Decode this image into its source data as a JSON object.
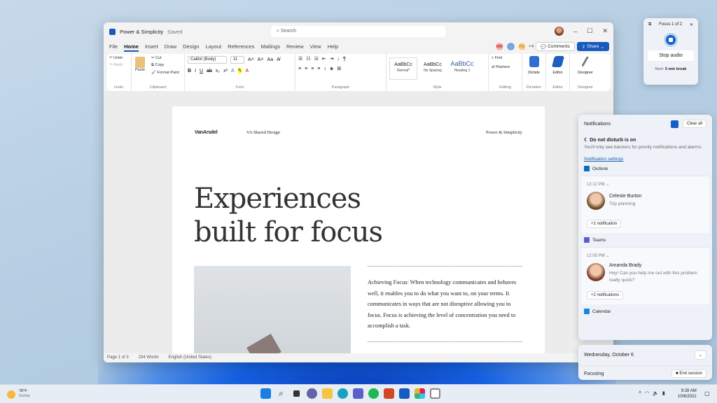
{
  "word": {
    "doc_title": "Power & Simplicity",
    "save_state": "Saved",
    "search_placeholder": "Search",
    "tabs": [
      "File",
      "Home",
      "Insert",
      "Draw",
      "Design",
      "Layout",
      "References",
      "Mailings",
      "Review",
      "View",
      "Help"
    ],
    "active_tab": "Home",
    "collaborators": [
      "MM",
      "",
      "FS"
    ],
    "collab_more": "+4",
    "comments_label": "Comments",
    "share_label": "Share",
    "ribbon": {
      "undo": "Undo",
      "redo": "Redo",
      "undo_group": "Undo",
      "paste": "Paste",
      "cut": "Cut",
      "copy": "Copy",
      "format_paint": "Format Paint",
      "clipboard_group": "Clipboard",
      "font_name": "Calibri (Body)",
      "font_size": "11",
      "font_group": "Font",
      "paragraph_group": "Paragraph",
      "styles": [
        {
          "sample": "AaBbCc",
          "name": "Normal*"
        },
        {
          "sample": "AaBbCc",
          "name": "No Spacing"
        },
        {
          "sample": "AaBbCc",
          "name": "Heading 1"
        }
      ],
      "style_group": "Style",
      "find": "Find",
      "replace": "Replace",
      "editing_group": "Editing",
      "dictate": "Dictate",
      "dictation_group": "Dictation",
      "editor": "Editor",
      "editor_group": "Editor",
      "designer": "Designer",
      "designer_group": "Designer"
    },
    "page": {
      "brand": "VanArsdel",
      "header_center": "VA Shared Design",
      "header_right": "Power & Simplicity",
      "heading_line1": "Experiences",
      "heading_line2": "built for focus",
      "body": "Achieving Focus: When technology communicates and behaves well, it enables you to do what you want to, on your terms. It communicates in ways that are not disruptive allowing you to focus. Focus is achieving the level of concentration you need to accomplish a task."
    },
    "status": {
      "page": "Page 1 of 3",
      "words": "234 Words",
      "language": "English (United States)"
    }
  },
  "focus_widget": {
    "title": "Focus 1 of 2",
    "stop_audio": "Stop audio",
    "next_label": "Next:",
    "next_value": "5 min break"
  },
  "notifications": {
    "title": "Notifications",
    "clear_all": "Clear all",
    "dnd_title": "Do not disturb is on",
    "dnd_text": "You'll only see banners for priority notifications and alarms.",
    "settings_link": "Notification settings",
    "groups": [
      {
        "app": "Outlook",
        "time": "12:12 PM",
        "sender": "Celeste Burton",
        "message": "Trip planning",
        "more": "+1 notification",
        "color": "#0f6cbd"
      },
      {
        "app": "Teams",
        "time": "12:05 PM",
        "sender": "Amanda Brady",
        "message": "Hey! Can you help me out with this problem really quick?",
        "more": "+2 notifications",
        "color": "#5b5fc7"
      },
      {
        "app": "Calendar",
        "color": "#1a86d9"
      }
    ]
  },
  "calendar": {
    "date": "Wednesday, October 6",
    "focusing": "Focusing",
    "end_session": "End session"
  },
  "taskbar": {
    "weather_temp": "78°F",
    "weather_desc": "Sunny",
    "apps": [
      "start",
      "search",
      "task-view",
      "chat",
      "file-explorer",
      "edge",
      "teams",
      "spotify",
      "powerpoint",
      "word",
      "slack",
      "clock"
    ],
    "time": "9:28 AM",
    "date": "10/6/2021"
  }
}
